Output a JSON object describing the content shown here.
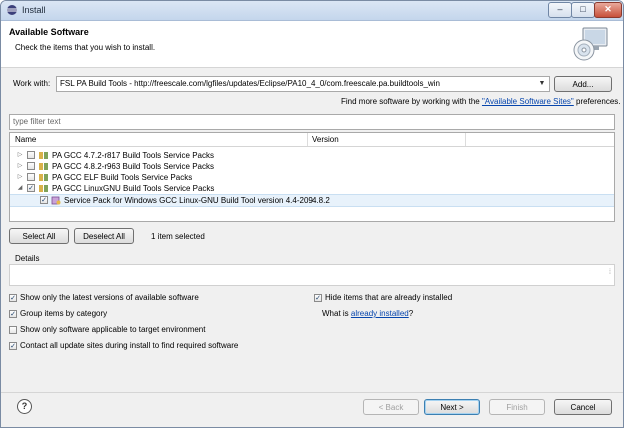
{
  "window": {
    "title": "Install",
    "controls": [
      "–",
      "□",
      "✕"
    ]
  },
  "banner": {
    "heading": "Available Software",
    "subtitle": "Check the items that you wish to install."
  },
  "work_with": {
    "label": "Work with:",
    "value": "FSL PA Build Tools - http://freescale.com/lgfiles/updates/Eclipse/PA10_4_0/com.freescale.pa.buildtools_win",
    "add_button": "Add...",
    "more_prefix": "Find more software by working with the",
    "more_link": "\"Available Software Sites\"",
    "more_suffix": "preferences."
  },
  "filter": {
    "placeholder": "type filter text"
  },
  "tree": {
    "columns": [
      "Name",
      "Version"
    ],
    "rows": [
      {
        "name": "PA GCC 4.7.2-r817 Build Tools Service Packs",
        "version": "",
        "checked": false,
        "expander": "▷"
      },
      {
        "name": "PA GCC 4.8.2-r963 Build Tools Service Packs",
        "version": "",
        "checked": false,
        "expander": "▷"
      },
      {
        "name": "PA GCC ELF Build Tools Service Packs",
        "version": "",
        "checked": false,
        "expander": "▷"
      },
      {
        "name": "PA GCC LinuxGNU Build Tools Service Packs",
        "version": "",
        "checked": true,
        "expander": "◢"
      },
      {
        "name": "Service Pack for Windows GCC Linux-GNU Build Tool version 4.4-209",
        "version": "4.8.2",
        "checked": true,
        "expander": ""
      }
    ]
  },
  "selection": {
    "select_all": "Select All",
    "deselect_all": "Deselect All",
    "status": "1 item selected"
  },
  "details": {
    "label": "Details"
  },
  "options": {
    "latest_versions": {
      "label": "Show only the latest versions of available software",
      "checked": true
    },
    "group_by_category": {
      "label": "Group items by category",
      "checked": true
    },
    "target_env": {
      "label": "Show only software applicable to target environment",
      "checked": false
    },
    "contact_sites": {
      "label": "Contact all update sites during install to find required software",
      "checked": true
    },
    "hide_installed": {
      "label": "Hide items that are already installed",
      "checked": true
    },
    "what_is_prefix": "What is",
    "what_is_link": "already installed",
    "what_is_suffix": "?"
  },
  "footer": {
    "help": "?",
    "back": "< Back",
    "next": "Next >",
    "finish": "Finish",
    "cancel": "Cancel"
  },
  "check_mark": "✓"
}
